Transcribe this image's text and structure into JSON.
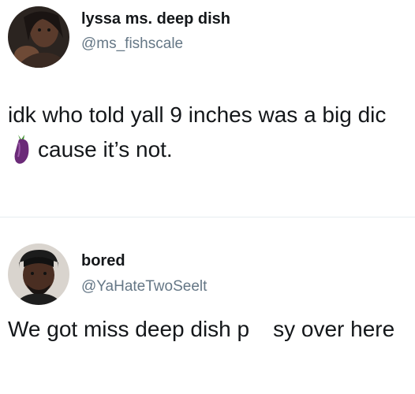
{
  "tweets": [
    {
      "display_name": "lyssa ms. deep dish",
      "handle": "@ms_fishscale",
      "text_part1": "idk who told yall 9 inches was a big dic",
      "emoji": "eggplant-icon",
      "text_part2": "cause it’s not."
    },
    {
      "display_name": "bored",
      "handle": "@YaHateTwoSeelt",
      "text_part1": "We got miss deep dish p",
      "text_part2": "sy over here"
    }
  ],
  "colors": {
    "text": "#14171a",
    "handle": "#657786",
    "divider": "#e6ecf0",
    "eggplant": "#6b2a78"
  }
}
